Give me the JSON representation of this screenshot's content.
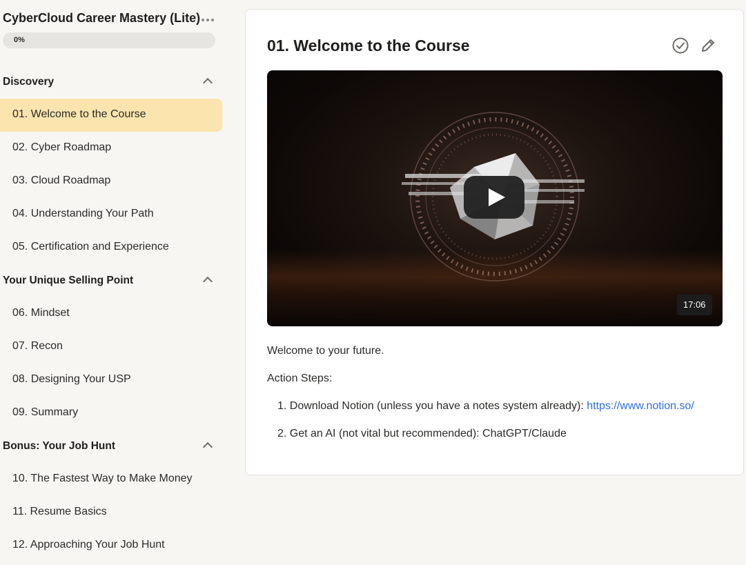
{
  "course": {
    "title": "CyberCloud Career Mastery (Lite)",
    "progress_label": "0%",
    "progress_value": 0
  },
  "sections": [
    {
      "title": "Discovery",
      "lessons": [
        "01. Welcome to the Course",
        "02. Cyber Roadmap",
        "03. Cloud Roadmap",
        "04. Understanding Your Path",
        "05. Certification and Experience"
      ]
    },
    {
      "title": "Your Unique Selling Point",
      "lessons": [
        "06. Mindset",
        "07. Recon",
        "08. Designing Your USP",
        "09. Summary"
      ]
    },
    {
      "title": "Bonus: Your Job Hunt",
      "lessons": [
        "10. The Fastest Way to Make Money",
        "11. Resume Basics",
        "12. Approaching Your Job Hunt"
      ]
    }
  ],
  "main": {
    "title": "01. Welcome to the Course",
    "video_duration": "17:06",
    "intro": "Welcome to your future.",
    "steps_heading": "Action Steps:",
    "step1_prefix": "1. Download Notion (unless you have a notes system already): ",
    "step1_link": "https://www.notion.so/",
    "step2": "2. Get an AI (not vital but recommended): ChatGPT/Claude"
  },
  "icons": {
    "more": "more-horizontal-icon",
    "collapse": "chevron-up-icon",
    "complete": "check-circle-icon",
    "edit": "pencil-icon",
    "play": "play-icon"
  },
  "colors": {
    "active_lesson_bg": "#fbe4ae",
    "link": "#2d6fe0"
  }
}
